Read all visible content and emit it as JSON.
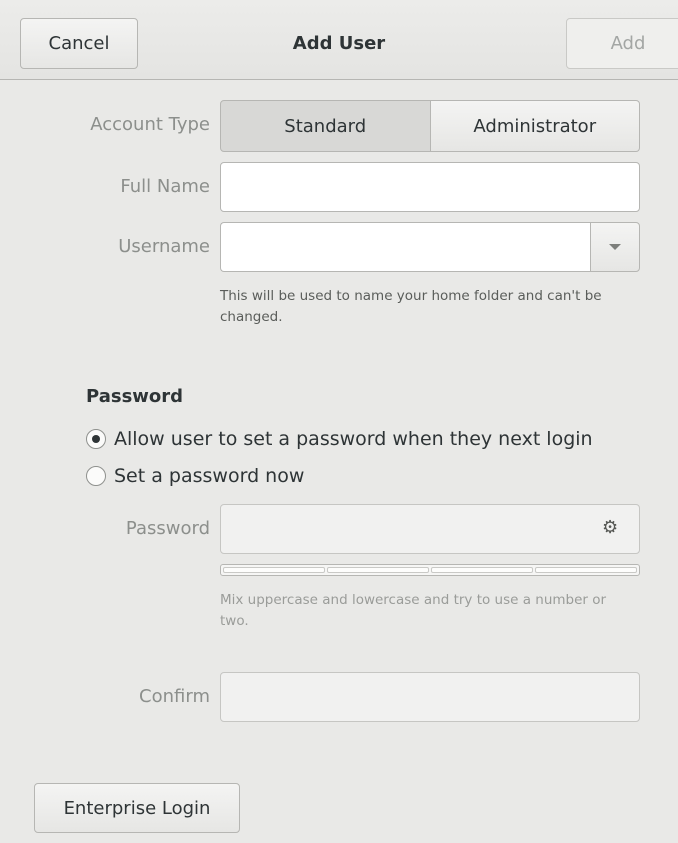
{
  "header": {
    "cancel_label": "Cancel",
    "title": "Add User",
    "add_label": "Add"
  },
  "account_type": {
    "label": "Account Type",
    "options": [
      "Standard",
      "Administrator"
    ],
    "selected": "Standard"
  },
  "full_name": {
    "label": "Full Name",
    "value": ""
  },
  "username": {
    "label": "Username",
    "value": "",
    "hint": "This will be used to name your home folder and can't be changed."
  },
  "password_section": {
    "heading": "Password",
    "options": [
      {
        "label": "Allow user to set a password when they next login",
        "checked": true
      },
      {
        "label": "Set a password now",
        "checked": false
      }
    ],
    "password_label": "Password",
    "password_value": "",
    "generate_icon": "gear-icon",
    "strength_segments": 4,
    "strength_level": 0,
    "password_hint": "Mix uppercase and lowercase and try to use a number or two.",
    "confirm_label": "Confirm",
    "confirm_value": ""
  },
  "footer": {
    "enterprise_label": "Enterprise Login"
  },
  "colors": {
    "background": "#e9e9e7",
    "text": "#2e3436",
    "label": "#8c8f8c",
    "disabled_text": "#a3a6a4"
  }
}
